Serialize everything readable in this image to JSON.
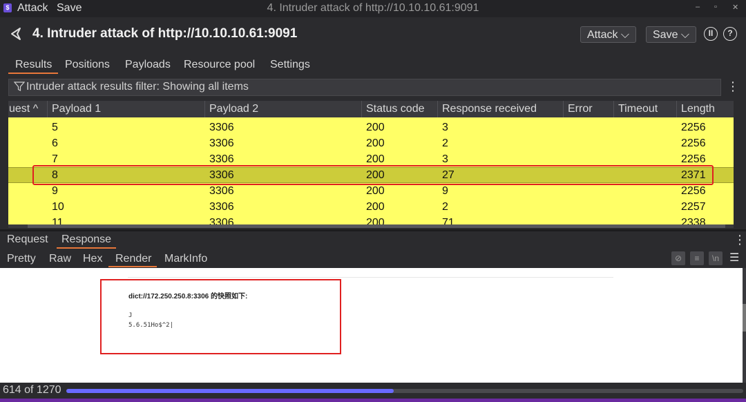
{
  "window": {
    "app_icon": "$",
    "menu": [
      "Attack",
      "Save"
    ],
    "title": "4. Intruder attack of http://10.10.10.61:9091",
    "controls": [
      "–",
      "▫",
      "✕"
    ]
  },
  "header": {
    "title": "4. Intruder attack of http://10.10.10.61:9091",
    "attack_button": "Attack ⌵",
    "save_button": "Save ⌵",
    "pause_icon": "pause-icon",
    "help_icon": "help-icon"
  },
  "tabs": [
    "Results",
    "Positions",
    "Payloads",
    "Resource pool",
    "Settings"
  ],
  "filter": {
    "text": "Intruder attack results filter: Showing all items"
  },
  "table": {
    "columns": [
      "uest ^",
      "Payload 1",
      "Payload 2",
      "Status code",
      "Response received",
      "Error",
      "Timeout",
      "Length"
    ],
    "rows": [
      {
        "payload1": "5",
        "payload2": "3306",
        "status": "200",
        "received": "3",
        "length": "2256"
      },
      {
        "payload1": "6",
        "payload2": "3306",
        "status": "200",
        "received": "2",
        "length": "2256"
      },
      {
        "payload1": "7",
        "payload2": "3306",
        "status": "200",
        "received": "3",
        "length": "2256"
      },
      {
        "payload1": "8",
        "payload2": "3306",
        "status": "200",
        "received": "27",
        "length": "2371"
      },
      {
        "payload1": "9",
        "payload2": "3306",
        "status": "200",
        "received": "9",
        "length": "2256"
      },
      {
        "payload1": "10",
        "payload2": "3306",
        "status": "200",
        "received": "2",
        "length": "2257"
      },
      {
        "payload1": "11",
        "payload2": "3306",
        "status": "200",
        "received": "71",
        "length": "2338"
      }
    ],
    "selected_row_index": 3
  },
  "message_tabs": [
    "Request",
    "Response"
  ],
  "view_tabs": [
    "Pretty",
    "Raw",
    "Hex",
    "Render",
    "MarkInfo"
  ],
  "render": {
    "heading": "dict://172.250.250.8:3306 的快照如下:",
    "line1": "J",
    "line2": "5.6.51Ho$^2|"
  },
  "progress": {
    "text": "614 of 1270",
    "fraction": 0.4835
  },
  "colors": {
    "row_highlight": "#ffff66",
    "selected_row": "#cccc3a",
    "accent": "#e8773a",
    "annotation_red": "#e02020",
    "progress": "#6a6aff"
  }
}
